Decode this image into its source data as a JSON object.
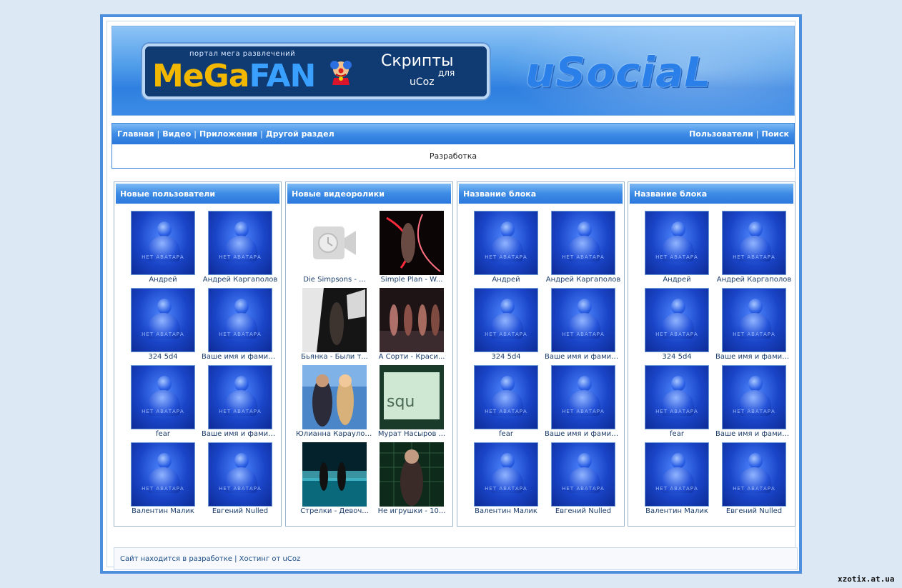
{
  "header": {
    "logo_slogan": "портал мега развлечений",
    "logo_brand_a": "MeGa",
    "logo_brand_b": "FAN",
    "logo_scripts": "Скрипты",
    "logo_for": "для",
    "logo_ucoz": "uCoz",
    "site_name": "uSociaL"
  },
  "nav": {
    "left": [
      "Главная",
      "Видео",
      "Приложения",
      "Другой раздел"
    ],
    "right": [
      "Пользователи",
      "Поиск"
    ],
    "separator": "|"
  },
  "dev_notice": "Разработка",
  "blocks": [
    {
      "title": "Новые пользователи",
      "kind": "users",
      "items": [
        "Андрей",
        "Андрей Каргаполов",
        "324 5d4",
        "Ваше имя и фамилия",
        "fear",
        "Ваше имя и фамилия",
        "Валентин Малик",
        "Евгений Nulled"
      ]
    },
    {
      "title": "Новые видеоролики",
      "kind": "videos",
      "items": [
        "Die Simpsons - ...",
        "Simple Plan - W...",
        "Бьянка - Были т...",
        "А Сорти - Краси...",
        "Юлианна Караулова",
        "Мурат Насыров ...",
        "Стрелки - Девоч...",
        "Не игрушки - 10..."
      ]
    },
    {
      "title": "Название блока",
      "kind": "users",
      "items": [
        "Андрей",
        "Андрей Каргаполов",
        "324 5d4",
        "Ваше имя и фамилия",
        "fear",
        "Ваше имя и фамилия",
        "Валентин Малик",
        "Евгений Nulled"
      ]
    },
    {
      "title": "Название блока",
      "kind": "users",
      "items": [
        "Андрей",
        "Андрей Каргаполов",
        "324 5d4",
        "Ваше имя и фамилия",
        "fear",
        "Ваше имя и фамилия",
        "Валентин Малик",
        "Евгений Nulled"
      ]
    }
  ],
  "avatar_placeholder_text": "НЕТ АВАТАРА",
  "footer": {
    "text_a": "Сайт находится в разработке",
    "separator": "|",
    "text_b": "Хостинг от",
    "text_c": "uCoz"
  },
  "watermark": "xzotix.at.ua",
  "colors": {
    "accent": "#3d8be5",
    "page_bg": "#dde8f5",
    "frame": "#4d8fdc"
  }
}
